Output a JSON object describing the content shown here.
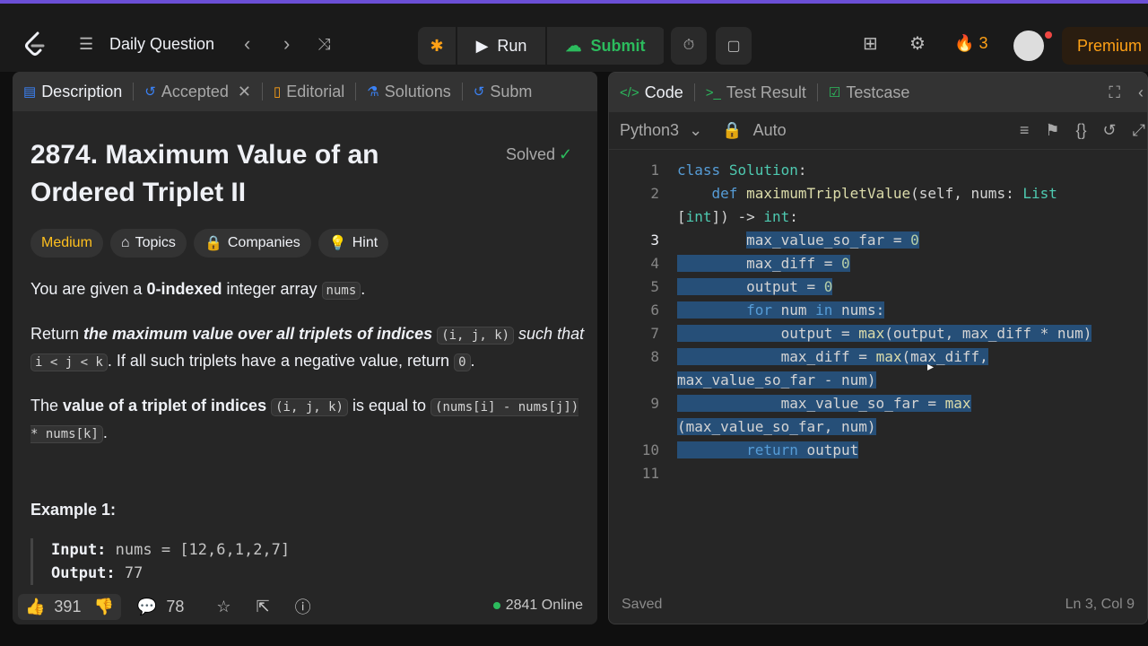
{
  "topbar": {
    "logo_icon": "leetcode-logo-icon",
    "question_list_label": "Daily Question",
    "run_label": "Run",
    "submit_label": "Submit",
    "streak_count": "3",
    "premium_label": "Premium",
    "accent_color": "#6b4fd6"
  },
  "left_tabs": [
    {
      "label": "Description"
    },
    {
      "label": "Accepted"
    },
    {
      "label": "Editorial"
    },
    {
      "label": "Solutions"
    },
    {
      "label": "Subm"
    }
  ],
  "problem": {
    "title": "2874. Maximum Value of an Ordered Triplet II",
    "status": "Solved",
    "difficulty": "Medium",
    "chips": [
      "Topics",
      "Companies",
      "Hint"
    ],
    "p1": {
      "a": "You are given a ",
      "b": "0-indexed",
      "c": " integer array ",
      "code": "nums",
      "d": "."
    },
    "p2": {
      "a": "Return ",
      "b": "the maximum value over all triplets of indices",
      "code1": "(i, j, k)",
      "c": " such that",
      "code2": "i < j < k",
      "d": ". If all such triplets have a negative value, return ",
      "code3": "0",
      "e": "."
    },
    "p3": {
      "a": "The ",
      "b": "value of a triplet of indices",
      "code1": "(i, j, k)",
      "c": " is equal to ",
      "code2": "(nums[i] - nums[j]) * nums[k]",
      "d": "."
    },
    "example_title": "Example 1:",
    "example_input_label": "Input:",
    "example_input": "nums = [12,6,1,2,7]",
    "example_output_label": "Output:",
    "example_output": "77"
  },
  "bottom": {
    "likes": "391",
    "comments": "78",
    "online": "2841 Online"
  },
  "right_tabs": [
    {
      "label": "Code"
    },
    {
      "label": "Test Result"
    },
    {
      "label": "Testcase"
    }
  ],
  "editor": {
    "language": "Python3",
    "mode": "Auto",
    "status": "Saved",
    "position": "Ln 3, Col 9"
  },
  "code_lines": [
    {
      "n": "1",
      "text": "class Solution:"
    },
    {
      "n": "2",
      "text": "    def maximumTripletValue(self, nums: List"
    },
    {
      "n": "",
      "text": "[int]) -> int:"
    },
    {
      "n": "3",
      "text": "        max_value_so_far = 0"
    },
    {
      "n": "4",
      "text": "        max_diff = 0"
    },
    {
      "n": "5",
      "text": "        output = 0"
    },
    {
      "n": "6",
      "text": "        for num in nums:"
    },
    {
      "n": "7",
      "text": "            output = max(output, max_diff * num)"
    },
    {
      "n": "8",
      "text": "            max_diff = max(max_diff,"
    },
    {
      "n": "",
      "text": "max_value_so_far - num)"
    },
    {
      "n": "9",
      "text": "            max_value_so_far = max"
    },
    {
      "n": "",
      "text": "(max_value_so_far, num)"
    },
    {
      "n": "10",
      "text": "        return output"
    },
    {
      "n": "11",
      "text": ""
    }
  ]
}
